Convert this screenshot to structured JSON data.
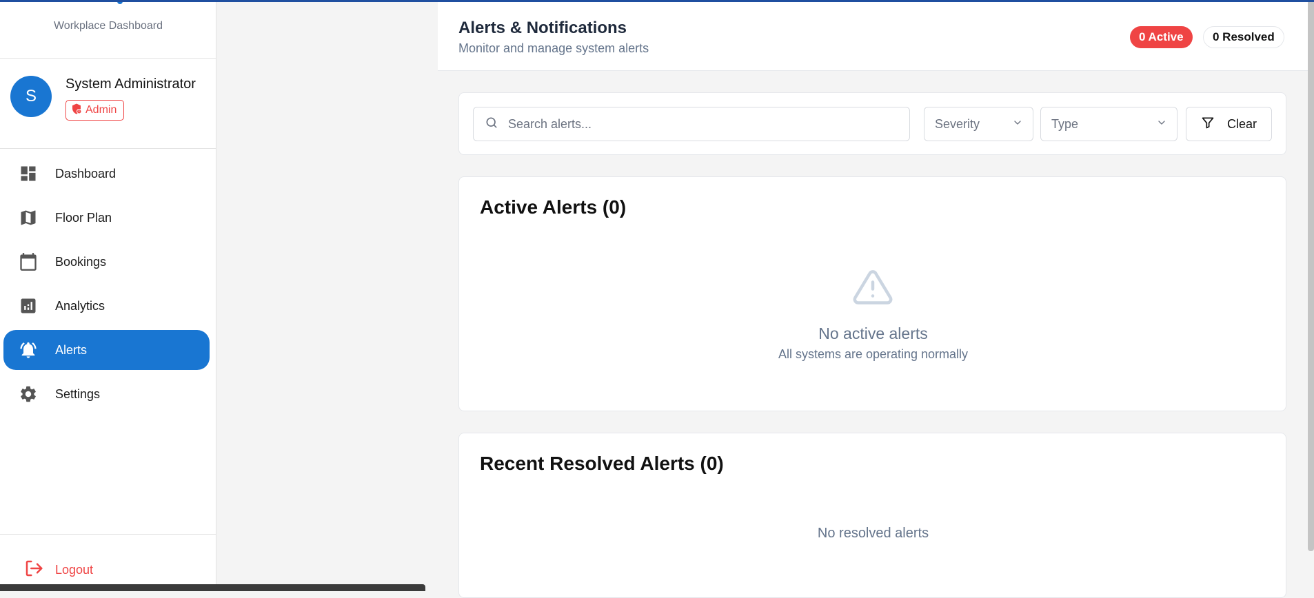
{
  "sidebar": {
    "brand_subtitle": "Workplace Dashboard",
    "user": {
      "initial": "S",
      "name": "System Administrator",
      "role": "Admin"
    },
    "nav": [
      {
        "label": "Dashboard",
        "icon": "dashboard-icon",
        "active": false
      },
      {
        "label": "Floor Plan",
        "icon": "map-icon",
        "active": false
      },
      {
        "label": "Bookings",
        "icon": "calendar-icon",
        "active": false
      },
      {
        "label": "Analytics",
        "icon": "analytics-icon",
        "active": false
      },
      {
        "label": "Alerts",
        "icon": "bell-icon",
        "active": true
      },
      {
        "label": "Settings",
        "icon": "gear-icon",
        "active": false
      }
    ],
    "logout_label": "Logout"
  },
  "header": {
    "title": "Alerts & Notifications",
    "subtitle": "Monitor and manage system alerts",
    "active_badge": "0 Active",
    "resolved_badge": "0 Resolved"
  },
  "filters": {
    "search_placeholder": "Search alerts...",
    "severity_label": "Severity",
    "type_label": "Type",
    "clear_label": "Clear"
  },
  "active_alerts": {
    "title": "Active Alerts (0)",
    "empty_title": "No active alerts",
    "empty_subtitle": "All systems are operating normally"
  },
  "resolved_alerts": {
    "title": "Recent Resolved Alerts (0)",
    "empty_text": "No resolved alerts"
  },
  "colors": {
    "primary": "#1976d2",
    "danger": "#ef4444",
    "muted": "#64748b"
  }
}
